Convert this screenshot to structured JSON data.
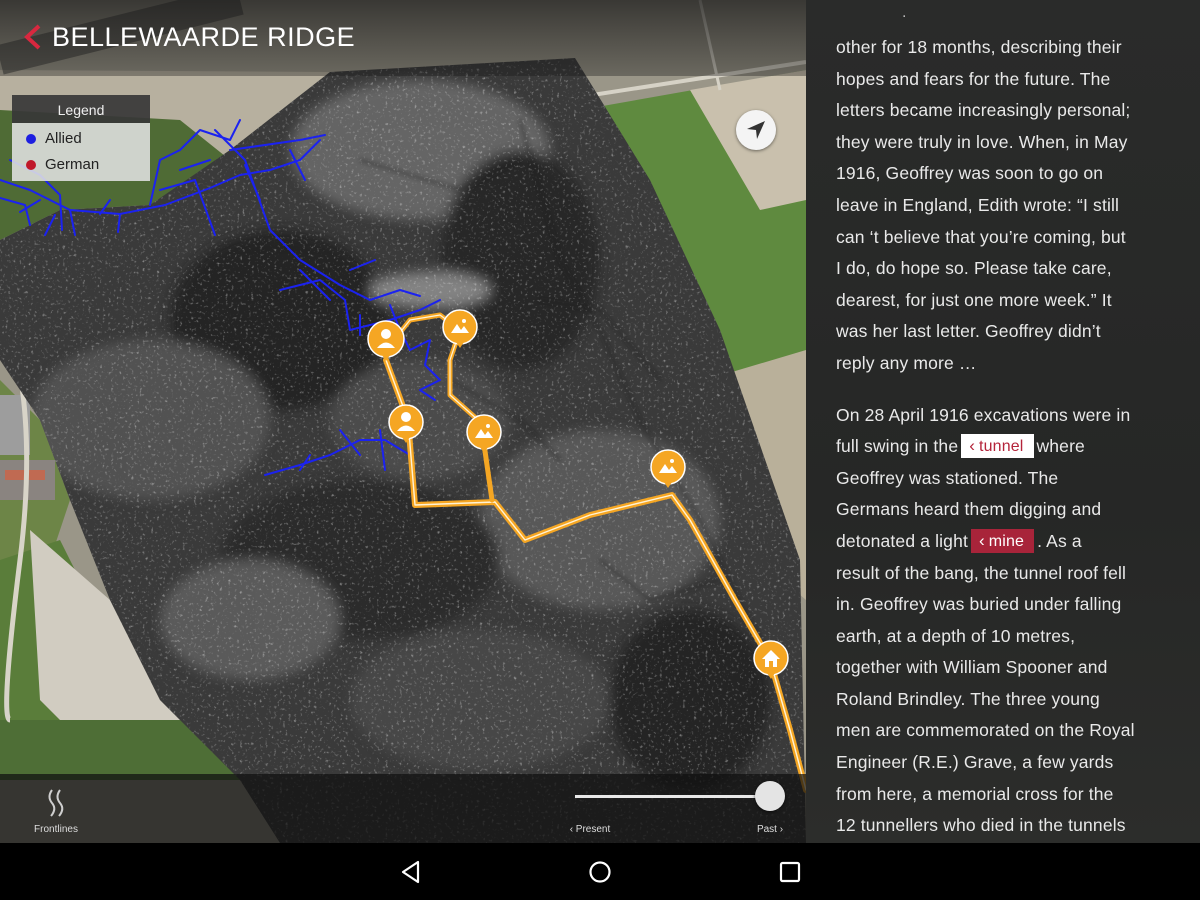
{
  "header": {
    "title": "BELLEWAARDE RIDGE"
  },
  "legend": {
    "title": "Legend",
    "items": [
      {
        "label": "Allied",
        "color": "#1d1ee0"
      },
      {
        "label": "German",
        "color": "#c0182a"
      }
    ]
  },
  "map": {
    "locate_icon": "navigation-arrow-icon",
    "route_color": "#f5a623",
    "markers": [
      {
        "type": "person-icon"
      },
      {
        "type": "person-icon"
      },
      {
        "type": "photo-icon"
      },
      {
        "type": "photo-icon"
      },
      {
        "type": "photo-icon"
      },
      {
        "type": "home-icon"
      }
    ]
  },
  "bottombar": {
    "frontlines_label": "Frontlines",
    "present_label": "‹ Present",
    "past_label": "Past ›",
    "timeline_position": 1.0
  },
  "story": {
    "top_mark": ".",
    "paragraph1": [
      "other for 18 months, describing their",
      "hopes and fears for the future. The",
      "letters became increasingly personal;",
      "they were truly in love. When, in May",
      "1916, Geoffrey was soon to go on",
      "leave in England, Edith wrote: “I still",
      "can ‘t believe that you’re coming, but",
      "I do, do hope so. Please take care,",
      "dearest, for just one more week.” It",
      "was her last letter. Geoffrey didn’t",
      "reply any more …"
    ],
    "p2_line1": "On 28 April 1916 excavations were in",
    "p2_line2_a": "full swing in the",
    "tunnel_link": "tunnel",
    "p2_line2_b": "where",
    "p2_line3": "Geoffrey was stationed. The",
    "p2_line4": "Germans heard them digging and",
    "p2_line5_a": "detonated a light",
    "mine_link": "mine",
    "p2_line5_b": ". As a",
    "paragraph2_rest": [
      "result of the bang, the tunnel roof fell",
      "in. Geoffrey was buried under falling",
      "earth, at a depth of 10 metres,",
      "together with William Spooner and",
      "Roland Brindley. The three young",
      "men are commemorated on the Royal",
      "Engineer (R.E.) Grave, a few yards",
      "from here, a memorial cross for the",
      "12 tunnellers who died in the tunnels"
    ]
  },
  "navbar": {
    "back": "back-triangle-icon",
    "home": "home-circle-icon",
    "recents": "recents-square-icon"
  },
  "colors": {
    "accent": "#a8243a",
    "panel": "#272827",
    "marker": "#f5a623"
  }
}
